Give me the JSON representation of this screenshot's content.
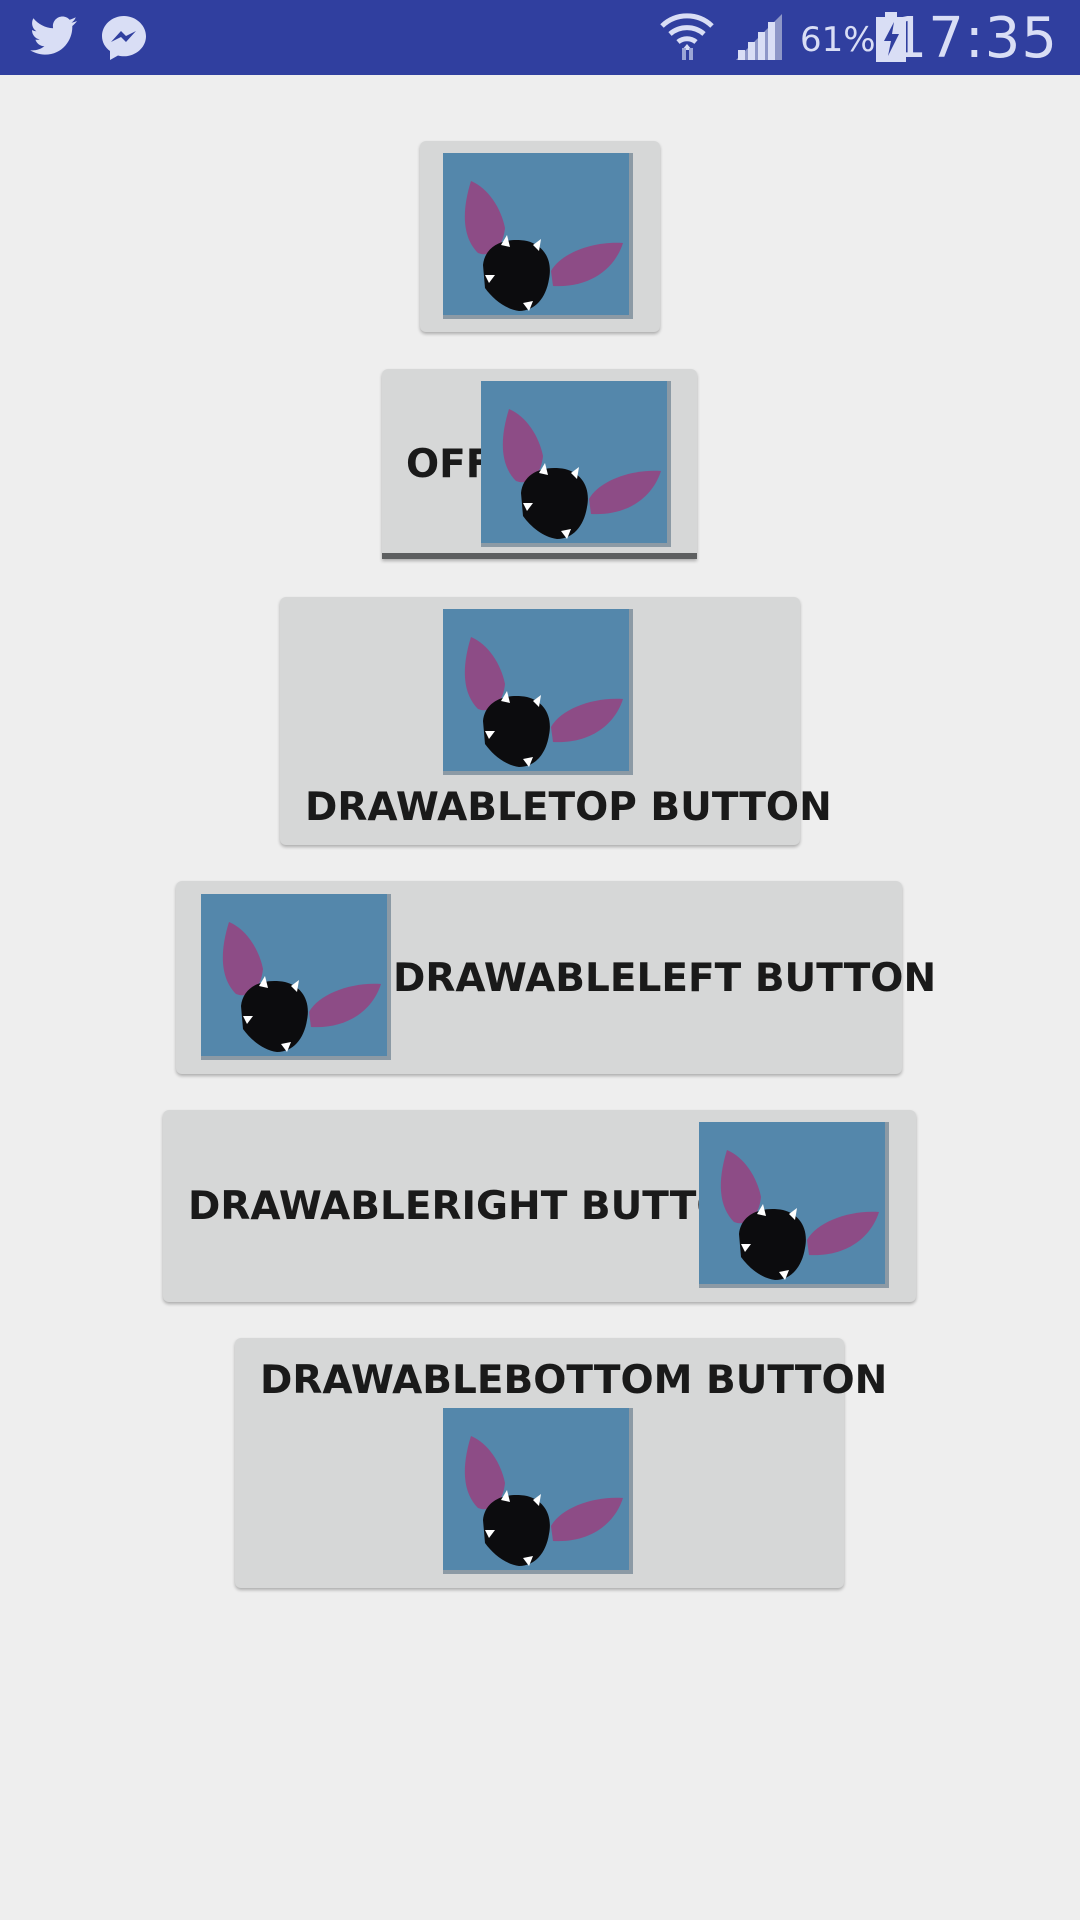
{
  "status_bar": {
    "time": "17:35",
    "battery_percent": "61%",
    "icons": [
      "twitter-icon",
      "messenger-icon",
      "wifi-icon",
      "signal-icon",
      "battery-charging-icon"
    ],
    "background": "#303f9f"
  },
  "buttons": {
    "image_button": {
      "image": "bat-image"
    },
    "toggle_button": {
      "label": "OFF",
      "image": "bat-image",
      "checked": false
    },
    "drawable_top": {
      "label": "DRAWABLETOP BUTTON",
      "image": "bat-image"
    },
    "drawable_left": {
      "label": "DRAWABLELEFT BUTTON",
      "image": "bat-image"
    },
    "drawable_right": {
      "label": "DRAWABLERIGHT BUTTON",
      "image": "bat-image"
    },
    "drawable_bottom": {
      "label": "DRAWABLEBOTTOM BUTTON",
      "image": "bat-image"
    }
  },
  "colors": {
    "background": "#eeeeee",
    "button": "#d6d7d7",
    "image_bg": "#5487ab",
    "ear": "#8d4c86"
  }
}
